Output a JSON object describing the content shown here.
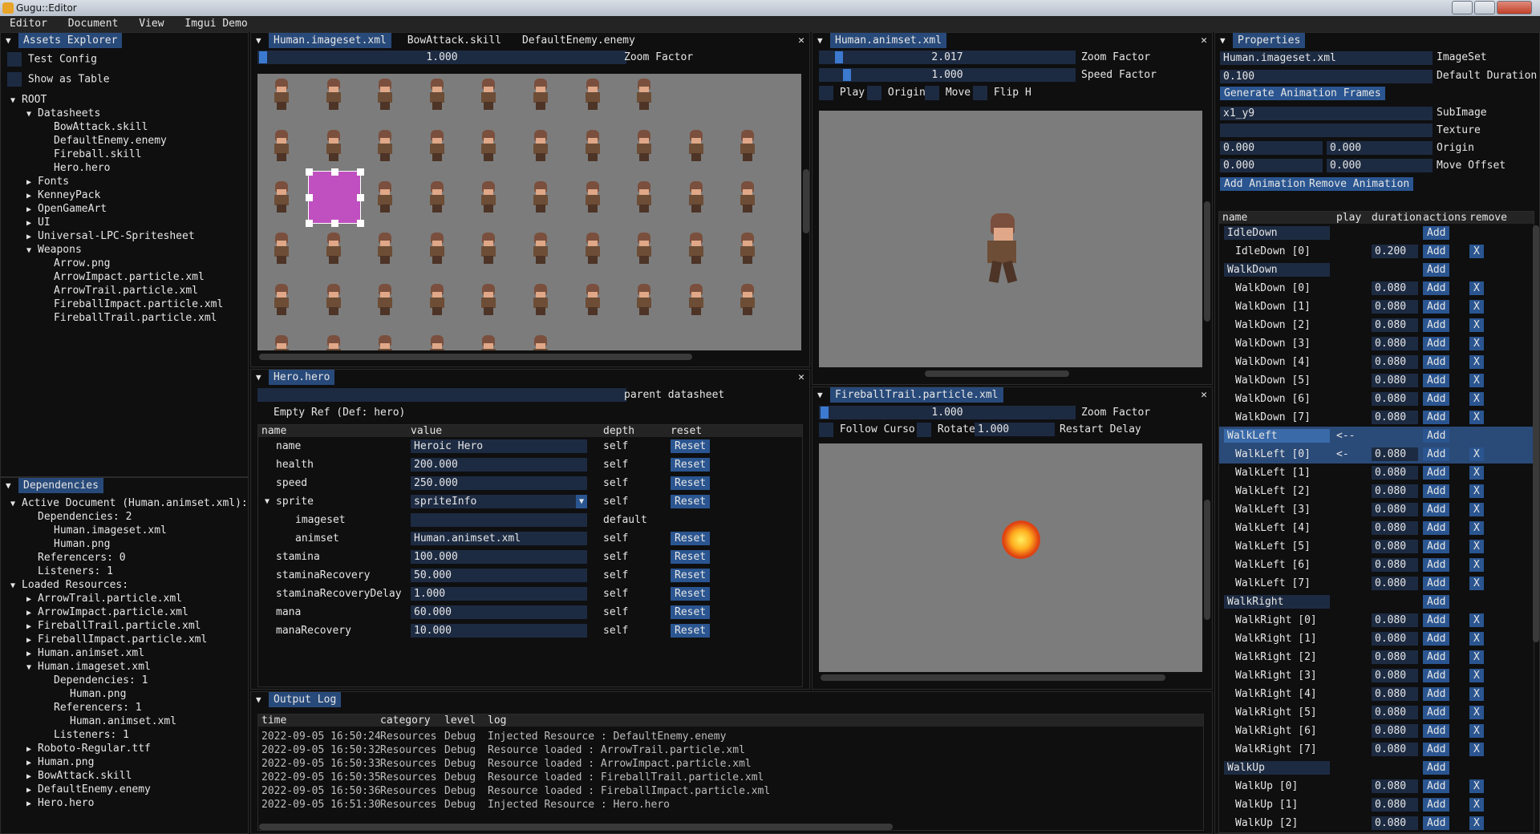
{
  "app": {
    "title": "Gugu::Editor"
  },
  "menu": [
    "Editor",
    "Document",
    "View",
    "Imgui Demo"
  ],
  "assets": {
    "title": "Assets Explorer",
    "test_config": "Test Config",
    "show_table": "Show as Table",
    "tree": [
      {
        "t": "ROOT",
        "d": 0,
        "a": "▼"
      },
      {
        "t": "Datasheets",
        "d": 1,
        "a": "▼"
      },
      {
        "t": "BowAttack.skill",
        "d": 2,
        "a": ""
      },
      {
        "t": "DefaultEnemy.enemy",
        "d": 2,
        "a": ""
      },
      {
        "t": "Fireball.skill",
        "d": 2,
        "a": ""
      },
      {
        "t": "Hero.hero",
        "d": 2,
        "a": ""
      },
      {
        "t": "Fonts",
        "d": 1,
        "a": "▶"
      },
      {
        "t": "KenneyPack",
        "d": 1,
        "a": "▶"
      },
      {
        "t": "OpenGameArt",
        "d": 1,
        "a": "▶"
      },
      {
        "t": "UI",
        "d": 1,
        "a": "▶"
      },
      {
        "t": "Universal-LPC-Spritesheet",
        "d": 1,
        "a": "▶"
      },
      {
        "t": "Weapons",
        "d": 1,
        "a": "▼"
      },
      {
        "t": "Arrow.png",
        "d": 2,
        "a": ""
      },
      {
        "t": "ArrowImpact.particle.xml",
        "d": 2,
        "a": ""
      },
      {
        "t": "ArrowTrail.particle.xml",
        "d": 2,
        "a": ""
      },
      {
        "t": "FireballImpact.particle.xml",
        "d": 2,
        "a": ""
      },
      {
        "t": "FireballTrail.particle.xml",
        "d": 2,
        "a": ""
      }
    ]
  },
  "deps": {
    "title": "Dependencies",
    "tree": [
      {
        "t": "Active Document (Human.animset.xml):",
        "d": 0,
        "a": "▼"
      },
      {
        "t": "Dependencies: 2",
        "d": 1,
        "a": ""
      },
      {
        "t": "Human.imageset.xml",
        "d": 2,
        "a": ""
      },
      {
        "t": "Human.png",
        "d": 2,
        "a": ""
      },
      {
        "t": "Referencers: 0",
        "d": 1,
        "a": ""
      },
      {
        "t": "Listeners: 1",
        "d": 1,
        "a": ""
      },
      {
        "t": "Loaded Resources:",
        "d": 0,
        "a": "▼"
      },
      {
        "t": "ArrowTrail.particle.xml",
        "d": 1,
        "a": "▶"
      },
      {
        "t": "ArrowImpact.particle.xml",
        "d": 1,
        "a": "▶"
      },
      {
        "t": "FireballTrail.particle.xml",
        "d": 1,
        "a": "▶"
      },
      {
        "t": "FireballImpact.particle.xml",
        "d": 1,
        "a": "▶"
      },
      {
        "t": "Human.animset.xml",
        "d": 1,
        "a": "▶"
      },
      {
        "t": "Human.imageset.xml",
        "d": 1,
        "a": "▼"
      },
      {
        "t": "Dependencies: 1",
        "d": 2,
        "a": ""
      },
      {
        "t": "Human.png",
        "d": 3,
        "a": ""
      },
      {
        "t": "Referencers: 1",
        "d": 2,
        "a": ""
      },
      {
        "t": "Human.animset.xml",
        "d": 3,
        "a": ""
      },
      {
        "t": "Listeners: 1",
        "d": 2,
        "a": ""
      },
      {
        "t": "Roboto-Regular.ttf",
        "d": 1,
        "a": "▶"
      },
      {
        "t": "Human.png",
        "d": 1,
        "a": "▶"
      },
      {
        "t": "BowAttack.skill",
        "d": 1,
        "a": "▶"
      },
      {
        "t": "DefaultEnemy.enemy",
        "d": 1,
        "a": "▶"
      },
      {
        "t": "Hero.hero",
        "d": 1,
        "a": "▶"
      }
    ]
  },
  "imageset": {
    "tabs": [
      "Human.imageset.xml",
      "BowAttack.skill",
      "DefaultEnemy.enemy"
    ],
    "zoom": "1.000",
    "zoom_label": "Zoom Factor"
  },
  "animset": {
    "tab": "Human.animset.xml",
    "zoom": "2.017",
    "zoom_label": "Zoom Factor",
    "speed": "1.000",
    "speed_label": "Speed Factor",
    "play": "Play",
    "origin": "Origin",
    "move": "Move",
    "flip": "Flip H"
  },
  "hero": {
    "tab": "Hero.hero",
    "parent_label": "parent datasheet",
    "empty_ref": "Empty Ref (Def: hero)",
    "cols": [
      "name",
      "value",
      "depth",
      "reset"
    ],
    "rows": [
      {
        "n": "name",
        "v": "Heroic Hero",
        "dp": "self",
        "r": "Reset",
        "ind": 0
      },
      {
        "n": "health",
        "v": "200.000",
        "dp": "self",
        "r": "Reset",
        "ind": 0
      },
      {
        "n": "speed",
        "v": "250.000",
        "dp": "self",
        "r": "Reset",
        "ind": 0
      },
      {
        "n": "sprite",
        "v": "spriteInfo",
        "dp": "self",
        "r": "Reset",
        "ind": 0,
        "combo": true,
        "arrow": "▼"
      },
      {
        "n": "imageset",
        "v": "",
        "dp": "default",
        "r": "",
        "ind": 1
      },
      {
        "n": "animset",
        "v": "Human.animset.xml",
        "dp": "self",
        "r": "Reset",
        "ind": 1
      },
      {
        "n": "stamina",
        "v": "100.000",
        "dp": "self",
        "r": "Reset",
        "ind": 0
      },
      {
        "n": "staminaRecovery",
        "v": "50.000",
        "dp": "self",
        "r": "Reset",
        "ind": 0
      },
      {
        "n": "staminaRecoveryDelay",
        "v": "1.000",
        "dp": "self",
        "r": "Reset",
        "ind": 0
      },
      {
        "n": "mana",
        "v": "60.000",
        "dp": "self",
        "r": "Reset",
        "ind": 0
      },
      {
        "n": "manaRecovery",
        "v": "10.000",
        "dp": "self",
        "r": "Reset",
        "ind": 0
      }
    ]
  },
  "particle": {
    "tab": "FireballTrail.particle.xml",
    "zoom": "1.000",
    "zoom_label": "Zoom Factor",
    "follow": "Follow Cursor",
    "rotate": "Rotate",
    "restart": "1.000",
    "restart_label": "Restart Delay"
  },
  "props": {
    "title": "Properties",
    "imageset_val": "Human.imageset.xml",
    "imageset_label": "ImageSet",
    "duration_val": "0.100",
    "duration_label": "Default Duration",
    "gen_btn": "Generate Animation Frames",
    "subimage_val": "x1_y9",
    "subimage_label": "SubImage",
    "texture_label": "Texture",
    "origin_x": "0.000",
    "origin_y": "0.000",
    "origin_label": "Origin",
    "move_x": "0.000",
    "move_y": "0.000",
    "move_label": "Move Offset",
    "add_anim": "Add Animation",
    "remove_anim": "Remove Animation",
    "cols": [
      "name",
      "play",
      "duration",
      "actions",
      "remove"
    ],
    "rows": [
      {
        "n": "IdleDown",
        "anim": true
      },
      {
        "n": "IdleDown [0]",
        "d": "0.200"
      },
      {
        "n": "WalkDown",
        "anim": true
      },
      {
        "n": "WalkDown [0]",
        "d": "0.080"
      },
      {
        "n": "WalkDown [1]",
        "d": "0.080"
      },
      {
        "n": "WalkDown [2]",
        "d": "0.080"
      },
      {
        "n": "WalkDown [3]",
        "d": "0.080"
      },
      {
        "n": "WalkDown [4]",
        "d": "0.080"
      },
      {
        "n": "WalkDown [5]",
        "d": "0.080"
      },
      {
        "n": "WalkDown [6]",
        "d": "0.080"
      },
      {
        "n": "WalkDown [7]",
        "d": "0.080"
      },
      {
        "n": "WalkLeft",
        "anim": true,
        "sel": true,
        "play": "<--"
      },
      {
        "n": "WalkLeft [0]",
        "d": "0.080",
        "sel": true,
        "play": "<-"
      },
      {
        "n": "WalkLeft [1]",
        "d": "0.080"
      },
      {
        "n": "WalkLeft [2]",
        "d": "0.080"
      },
      {
        "n": "WalkLeft [3]",
        "d": "0.080"
      },
      {
        "n": "WalkLeft [4]",
        "d": "0.080"
      },
      {
        "n": "WalkLeft [5]",
        "d": "0.080"
      },
      {
        "n": "WalkLeft [6]",
        "d": "0.080"
      },
      {
        "n": "WalkLeft [7]",
        "d": "0.080"
      },
      {
        "n": "WalkRight",
        "anim": true
      },
      {
        "n": "WalkRight [0]",
        "d": "0.080"
      },
      {
        "n": "WalkRight [1]",
        "d": "0.080"
      },
      {
        "n": "WalkRight [2]",
        "d": "0.080"
      },
      {
        "n": "WalkRight [3]",
        "d": "0.080"
      },
      {
        "n": "WalkRight [4]",
        "d": "0.080"
      },
      {
        "n": "WalkRight [5]",
        "d": "0.080"
      },
      {
        "n": "WalkRight [6]",
        "d": "0.080"
      },
      {
        "n": "WalkRight [7]",
        "d": "0.080"
      },
      {
        "n": "WalkUp",
        "anim": true
      },
      {
        "n": "WalkUp [0]",
        "d": "0.080"
      },
      {
        "n": "WalkUp [1]",
        "d": "0.080"
      },
      {
        "n": "WalkUp [2]",
        "d": "0.080"
      }
    ],
    "add": "Add",
    "x": "X"
  },
  "log": {
    "title": "Output Log",
    "cols": [
      "time",
      "category",
      "level",
      "log"
    ],
    "rows": [
      {
        "t": "2022-09-05 16:50:24",
        "c": "Resources",
        "l": "Debug",
        "m": "Injected Resource : DefaultEnemy.enemy"
      },
      {
        "t": "2022-09-05 16:50:32",
        "c": "Resources",
        "l": "Debug",
        "m": "Resource loaded : ArrowTrail.particle.xml"
      },
      {
        "t": "2022-09-05 16:50:33",
        "c": "Resources",
        "l": "Debug",
        "m": "Resource loaded : ArrowImpact.particle.xml"
      },
      {
        "t": "2022-09-05 16:50:35",
        "c": "Resources",
        "l": "Debug",
        "m": "Resource loaded : FireballTrail.particle.xml"
      },
      {
        "t": "2022-09-05 16:50:36",
        "c": "Resources",
        "l": "Debug",
        "m": "Resource loaded : FireballImpact.particle.xml"
      },
      {
        "t": "2022-09-05 16:51:30",
        "c": "Resources",
        "l": "Debug",
        "m": "Injected Resource : Hero.hero"
      }
    ]
  },
  "colors": {
    "accent": "#2a5590",
    "frame": "#1d2b42",
    "tab_active": "#284a7a",
    "selection": "#c050c0"
  }
}
